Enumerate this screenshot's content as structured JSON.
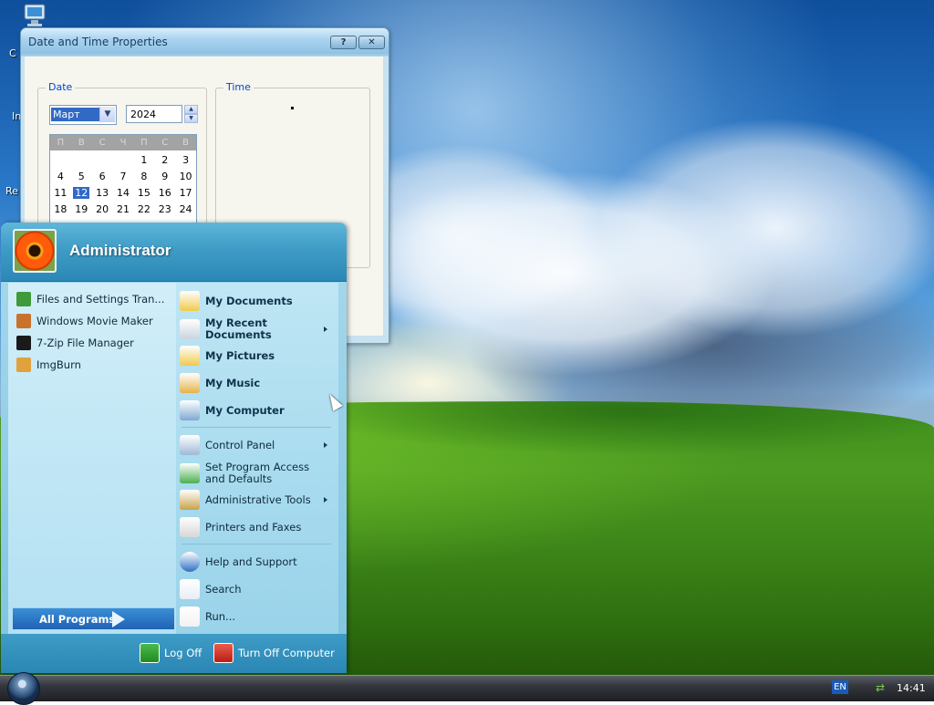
{
  "desktop": {
    "icon_labels": [
      "C",
      "In",
      "Re"
    ]
  },
  "date_time_window": {
    "title": "Date and Time Properties",
    "buttons": [
      "?",
      "✕"
    ],
    "date_group_label": "Date",
    "time_group_label": "Time",
    "month": "Март",
    "year": "2024",
    "weekday_headers": [
      "П",
      "В",
      "С",
      "Ч",
      "П",
      "С",
      "В"
    ],
    "calendar_days": [
      "",
      "",
      "",
      "",
      "1",
      "2",
      "3",
      "4",
      "5",
      "6",
      "7",
      "8",
      "9",
      "10",
      "11",
      "12",
      "13",
      "14",
      "15",
      "16",
      "17",
      "18",
      "19",
      "20",
      "21",
      "22",
      "23",
      "24"
    ],
    "selected_day": "12"
  },
  "start_menu": {
    "user_name": "Administrator",
    "pinned_programs": [
      {
        "label": "Files and Settings Tran...",
        "icon": "transfer-wizard-icon",
        "color": "#3f9a3a"
      },
      {
        "label": "Windows Movie Maker",
        "icon": "movie-maker-icon",
        "color": "#c9722c"
      },
      {
        "label": "7-Zip File Manager",
        "icon": "seven-zip-icon",
        "color": "#1a1a1a"
      },
      {
        "label": "ImgBurn",
        "icon": "imgburn-icon",
        "color": "#e0a23c"
      }
    ],
    "all_programs_label": "All Programs",
    "places": [
      {
        "label": "My Documents",
        "icon": "my-documents-icon",
        "bold": true
      },
      {
        "label": "My Recent Documents",
        "icon": "recent-documents-icon",
        "bold": true,
        "submenu": true
      },
      {
        "label": "My Pictures",
        "icon": "my-pictures-icon",
        "bold": true
      },
      {
        "label": "My Music",
        "icon": "my-music-icon",
        "bold": true
      },
      {
        "label": "My Computer",
        "icon": "my-computer-icon",
        "bold": true
      }
    ],
    "system_items": [
      {
        "label": "Control Panel",
        "icon": "control-panel-icon",
        "submenu": true
      },
      {
        "label": "Set Program Access and Defaults",
        "icon": "program-access-icon"
      },
      {
        "label": "Administrative Tools",
        "icon": "administrative-tools-icon",
        "submenu": true
      },
      {
        "label": "Printers and Faxes",
        "icon": "printers-icon"
      }
    ],
    "help_items": [
      {
        "label": "Help and Support",
        "icon": "help-icon"
      },
      {
        "label": "Search",
        "icon": "search-icon"
      },
      {
        "label": "Run...",
        "icon": "run-icon"
      }
    ],
    "log_off_label": "Log Off",
    "turn_off_label": "Turn Off Computer"
  },
  "taskbar": {
    "language": "EN",
    "clock": "14:41"
  },
  "colors": {
    "start_menu_header": "#3f9cc6",
    "selection": "#316ac5"
  }
}
